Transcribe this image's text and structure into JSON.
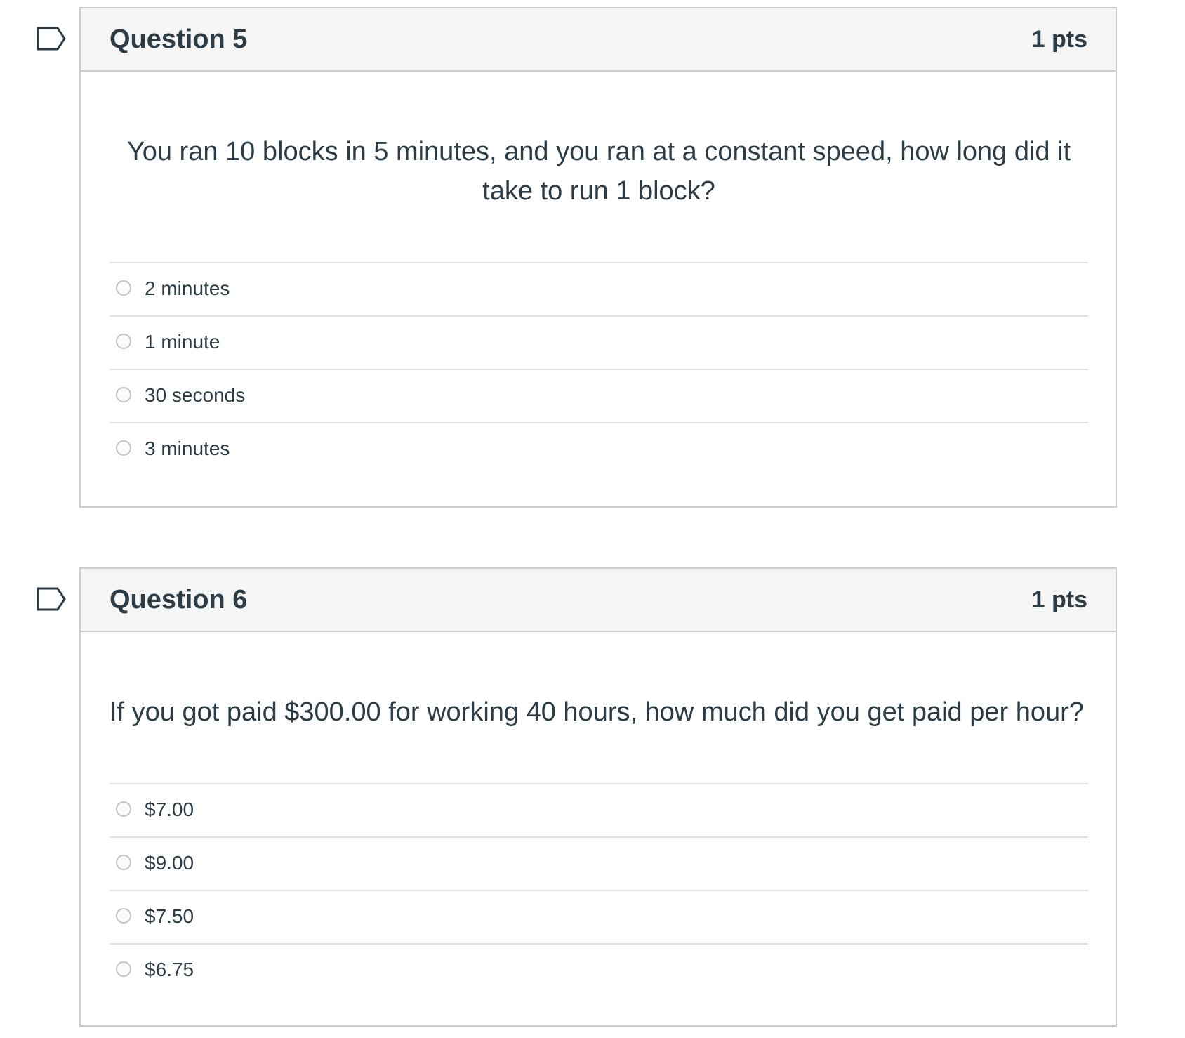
{
  "questions": [
    {
      "title": "Question 5",
      "points": "1 pts",
      "text": "You ran 10 blocks in 5 minutes, and you ran at a constant speed, how long did it take to run 1 block?",
      "answers": [
        "2 minutes",
        "1 minute",
        "30 seconds",
        "3 minutes"
      ],
      "flag_icon": "flag-outline-icon"
    },
    {
      "title": "Question 6",
      "points": "1 pts",
      "text": "If you got paid $300.00 for working 40 hours, how much did you get paid per hour?",
      "answers": [
        "$7.00",
        "$9.00",
        "$7.50",
        "$6.75"
      ],
      "flag_icon": "flag-outline-icon"
    }
  ],
  "colors": {
    "text": "#2d3b45",
    "border": "#c7cdd1",
    "header_bg": "#f5f5f5",
    "divider": "#dfe3e6"
  }
}
